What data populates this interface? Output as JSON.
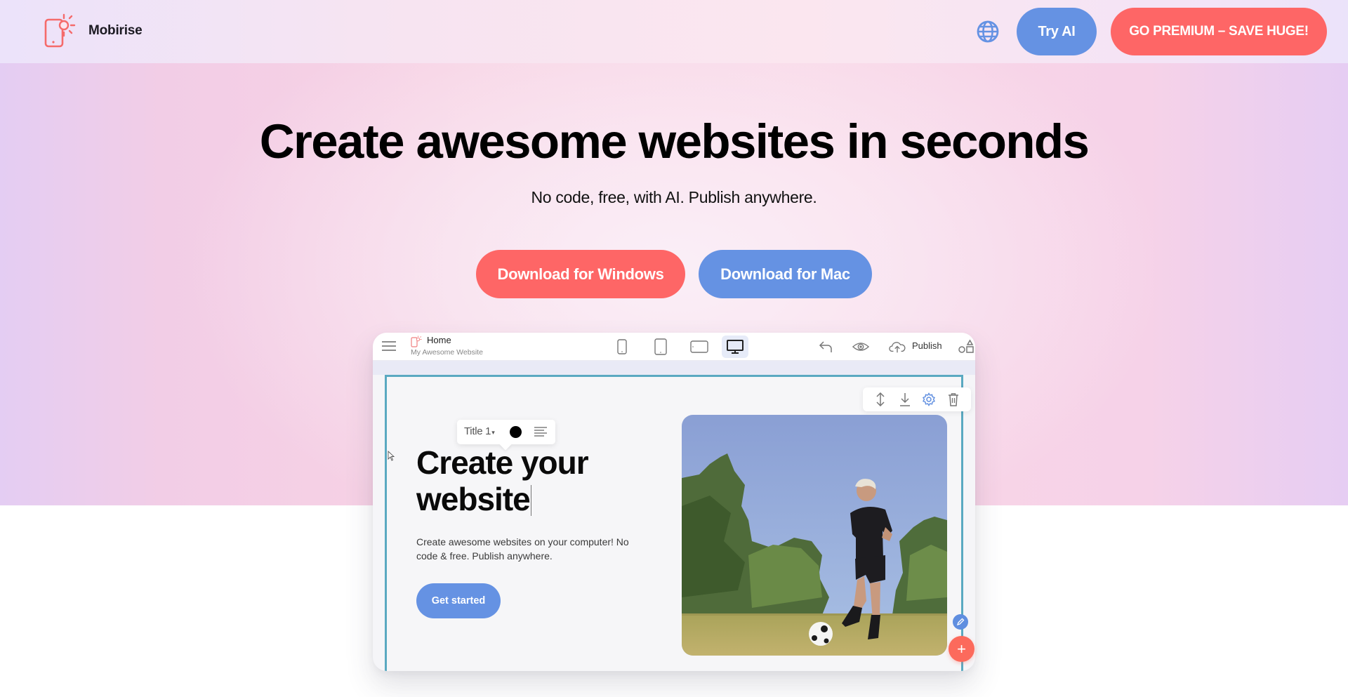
{
  "header": {
    "brand_name": "Mobirise",
    "language_icon": "globe-icon",
    "try_ai_label": "Try AI",
    "premium_label": "GO PREMIUM – SAVE HUGE!"
  },
  "hero": {
    "title": "Create awesome websites in seconds",
    "subtitle": "No code, free, with AI. Publish anywhere.",
    "download_windows_label": "Download for Windows",
    "download_mac_label": "Download for Mac"
  },
  "editor": {
    "page_name": "Home",
    "site_name": "My Awesome Website",
    "devices": [
      {
        "name": "phone",
        "active": false
      },
      {
        "name": "phone-large",
        "active": false
      },
      {
        "name": "tablet",
        "active": false
      },
      {
        "name": "desktop",
        "active": true
      }
    ],
    "publish_label": "Publish",
    "text_toolbar": {
      "style_label": "Title 1",
      "color": "#000000"
    },
    "block": {
      "title_line1": "Create your",
      "title_line2": "website",
      "description": "Create awesome websites on your computer! No code & free. Publish anywhere.",
      "cta_label": "Get started",
      "image_alt": "Soccer player kicking a ball on a grassy field"
    }
  },
  "colors": {
    "primary_blue": "#6592e3",
    "primary_red": "#fe6666",
    "selection_border": "#5aa9c1"
  }
}
